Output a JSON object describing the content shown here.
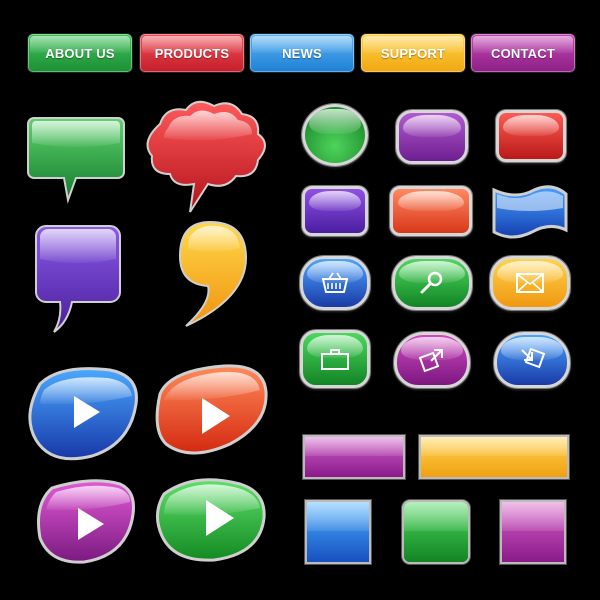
{
  "nav": {
    "about": "ABOUT US",
    "products": "PRODUCTS",
    "news": "NEWS",
    "support": "SUPPORT",
    "contact": "CONTACT"
  },
  "colors": {
    "green": "#1f9a3a",
    "red": "#d6252e",
    "blue": "#2a8fe0",
    "yellow": "#f2b21c",
    "purple": "#8a2a9c",
    "violet": "#6a3cbf",
    "orange": "#f07a1c",
    "magenta": "#b3248c"
  },
  "icons": [
    "basket-icon",
    "magnifier-icon",
    "envelope-icon",
    "briefcase-icon",
    "arrow-out-icon",
    "arrow-in-icon",
    "play-icon"
  ]
}
